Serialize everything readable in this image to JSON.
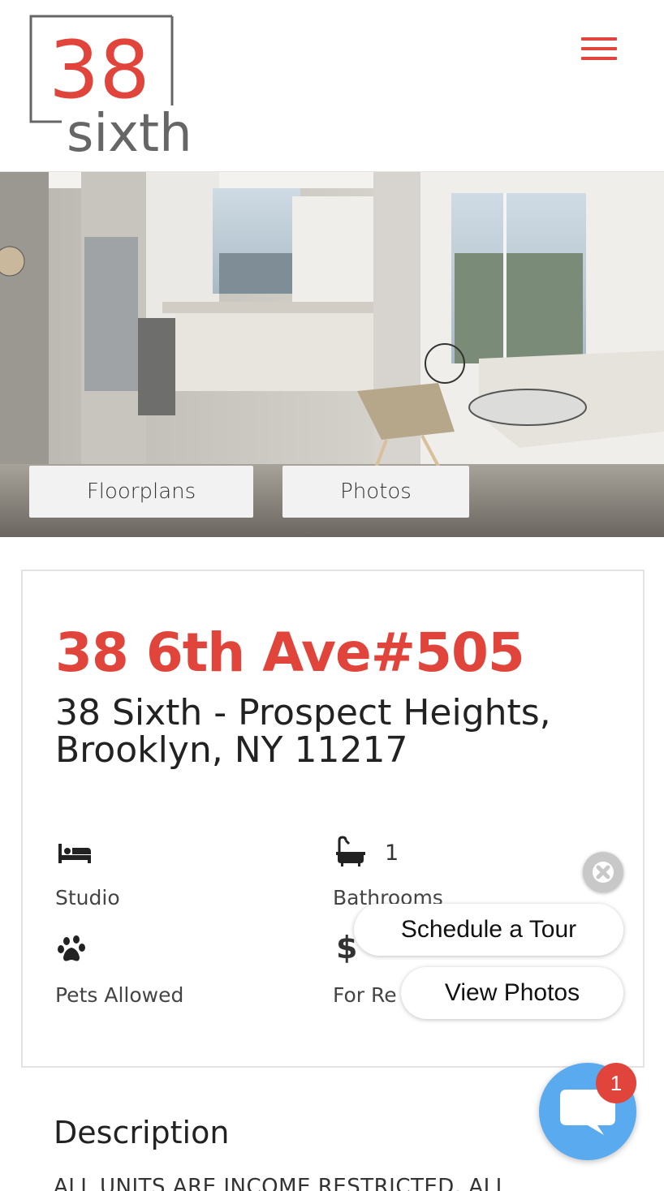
{
  "header": {
    "logo_number": "38",
    "logo_word": "sixth",
    "menu_icon": "hamburger-menu-icon"
  },
  "hero": {
    "floorplans_label": "Floorplans",
    "photos_label": "Photos"
  },
  "listing": {
    "title": "38 6th Ave#505",
    "address": "38 Sixth - Prospect Heights, Brooklyn, NY 11217",
    "features": {
      "bedroom": {
        "icon": "bed-icon",
        "label": "Studio"
      },
      "bathroom": {
        "icon": "bathtub-icon",
        "count": "1",
        "label": "Bathrooms"
      },
      "pets": {
        "icon": "paw-icon",
        "label": "Pets Allowed"
      },
      "rent": {
        "icon": "dollar-icon",
        "symbol": "$",
        "label": "For Re"
      }
    }
  },
  "description": {
    "heading": "Description",
    "text": "ALL UNITS ARE INCOME RESTRICTED. ALL"
  },
  "widgets": {
    "schedule_tour": "Schedule a Tour",
    "view_photos": "View Photos",
    "chat_badge_count": "1"
  },
  "colors": {
    "brand_red": "#e0443a",
    "logo_gray": "#666666",
    "chat_blue": "#5aaaf0"
  }
}
